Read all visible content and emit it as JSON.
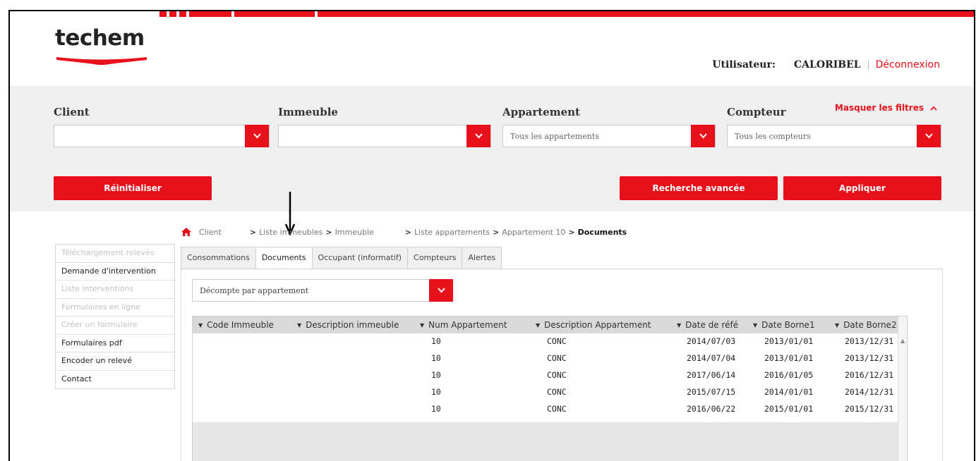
{
  "brand": {
    "logo_text": "techem",
    "accent_color": "#e8101a"
  },
  "user": {
    "label": "Utilisateur:",
    "name": "CALORIBEL",
    "logout_label": "Déconnexion"
  },
  "filters": {
    "client": {
      "label": "Client",
      "value": ""
    },
    "immeuble": {
      "label": "Immeuble",
      "value": ""
    },
    "appartement": {
      "label": "Appartement",
      "value": "Tous les appartements"
    },
    "compteur": {
      "label": "Compteur",
      "value": "Tous les compteurs"
    },
    "toggle_label": "Masquer les filtres"
  },
  "buttons": {
    "reset": "Réinitialiser",
    "advanced_search": "Recherche avancée",
    "apply": "Appliquer"
  },
  "breadcrumb": {
    "items": [
      "Client",
      "Liste immeubles",
      "Immeuble",
      "Liste appartements",
      "Appartement 10"
    ],
    "current": "Documents"
  },
  "side_menu": [
    {
      "label": "Téléchargement relevés",
      "enabled": false
    },
    {
      "label": "Demande d'intervention",
      "enabled": true
    },
    {
      "label": "Liste interventions",
      "enabled": false
    },
    {
      "label": "Formulaires en ligne",
      "enabled": false
    },
    {
      "label": "Créer un formulaire",
      "enabled": false
    },
    {
      "label": "Formulaires pdf",
      "enabled": true
    },
    {
      "label": "Encoder un relevé",
      "enabled": true
    },
    {
      "label": "Contact",
      "enabled": true
    }
  ],
  "tabs": [
    {
      "label": "Consommations",
      "active": false
    },
    {
      "label": "Documents",
      "active": true
    },
    {
      "label": "Occupant (informatif)",
      "active": false
    },
    {
      "label": "Compteurs",
      "active": false
    },
    {
      "label": "Alertes",
      "active": false
    }
  ],
  "document_type": {
    "value": "Décompte par appartement"
  },
  "grid": {
    "columns": [
      "Code Immeuble",
      "Description immeuble",
      "Num Appartement",
      "Description Appartement",
      "Date de réfé",
      "Date Borne1",
      "Date Borne2"
    ],
    "rows": [
      [
        "",
        "",
        "10",
        "CONC",
        "2014/07/03",
        "2013/01/01",
        "2013/12/31"
      ],
      [
        "",
        "",
        "10",
        "CONC",
        "2014/07/04",
        "2013/01/01",
        "2013/12/31"
      ],
      [
        "",
        "",
        "10",
        "CONC",
        "2017/06/14",
        "2016/01/05",
        "2016/12/31"
      ],
      [
        "",
        "",
        "10",
        "CONC",
        "2015/07/15",
        "2014/01/01",
        "2014/12/31"
      ],
      [
        "",
        "",
        "10",
        "CONC",
        "2016/06/22",
        "2015/01/01",
        "2015/12/31"
      ]
    ]
  }
}
